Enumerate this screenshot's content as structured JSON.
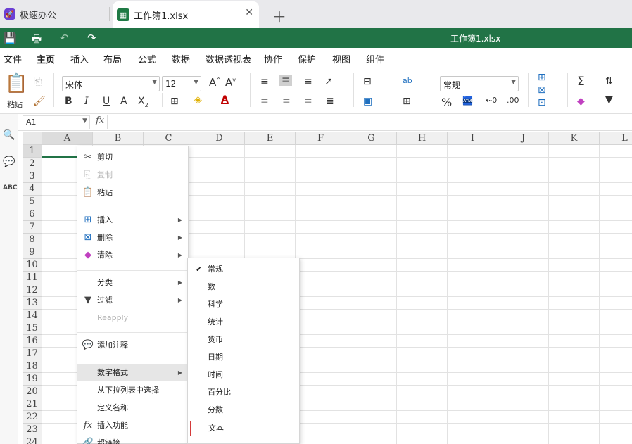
{
  "tabs": {
    "app_name": "极速办公",
    "doc_name": "工作簿1.xlsx"
  },
  "title_bar": {
    "title": "工作簿1.xlsx"
  },
  "menu": [
    "文件",
    "主页",
    "插入",
    "布局",
    "公式",
    "数据",
    "数据透视表",
    "协作",
    "保护",
    "视图",
    "组件"
  ],
  "ribbon": {
    "paste_label": "粘贴",
    "font_name": "宋体",
    "font_size": "12",
    "number_format": "常规"
  },
  "formula_bar": {
    "cell_ref": "A1",
    "fx": "fx"
  },
  "columns": [
    "A",
    "B",
    "C",
    "D",
    "E",
    "F",
    "G",
    "H",
    "I",
    "J",
    "K",
    "L"
  ],
  "rows": [
    "1",
    "2",
    "3",
    "4",
    "5",
    "6",
    "7",
    "8",
    "9",
    "10",
    "11",
    "12",
    "13",
    "14",
    "15",
    "16",
    "17",
    "18",
    "19",
    "20",
    "21",
    "22",
    "23",
    "24"
  ],
  "context_menu": [
    "剪切",
    "复制",
    "粘贴",
    "插入",
    "删除",
    "清除",
    "分类",
    "过滤",
    "Reapply",
    "添加注释",
    "数字格式",
    "从下拉列表中选择",
    "定义名称",
    "插入功能",
    "超链接"
  ],
  "number_format_menu": [
    "常规",
    "数",
    "科学",
    "统计",
    "货币",
    "日期",
    "时间",
    "百分比",
    "分数",
    "文本"
  ]
}
